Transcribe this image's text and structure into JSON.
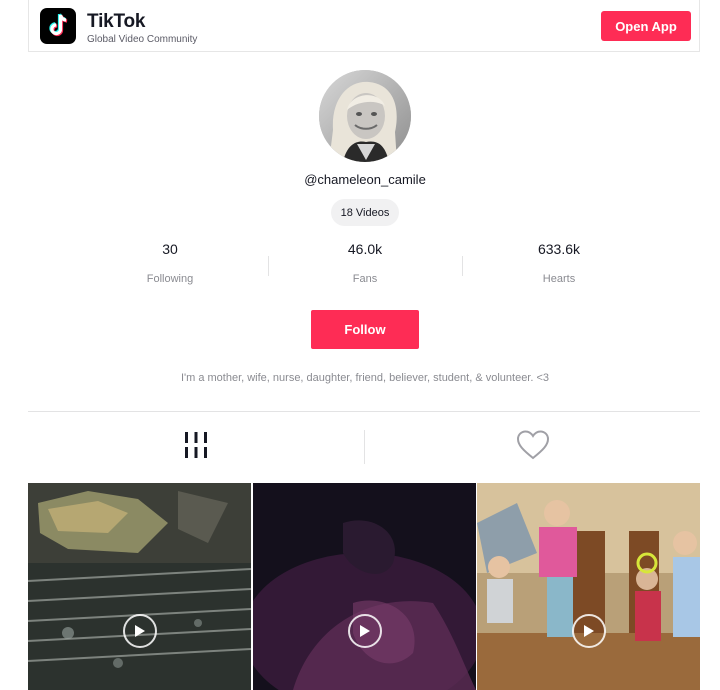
{
  "header": {
    "brand": "TikTok",
    "tagline": "Global Video Community",
    "open_app_label": "Open App",
    "logo_icon": "tiktok-logo-icon"
  },
  "profile": {
    "username": "@chameleon_camile",
    "videos_count": "18 Videos",
    "stats": [
      {
        "value": "30",
        "label": "Following"
      },
      {
        "value": "46.0k",
        "label": "Fans"
      },
      {
        "value": "633.6k",
        "label": "Hearts"
      }
    ],
    "follow_label": "Follow",
    "bio": "I'm a mother, wife, nurse, daughter, friend, believer, student, & volunteer. <3"
  },
  "tabs": [
    {
      "icon": "videos-grid-icon"
    },
    {
      "icon": "heart-icon"
    }
  ],
  "videos": [
    {
      "icon": "play-icon"
    },
    {
      "icon": "play-icon"
    },
    {
      "icon": "play-icon"
    }
  ],
  "colors": {
    "accent": "#fe2c55",
    "text": "#161823",
    "muted": "#8a8b91"
  }
}
